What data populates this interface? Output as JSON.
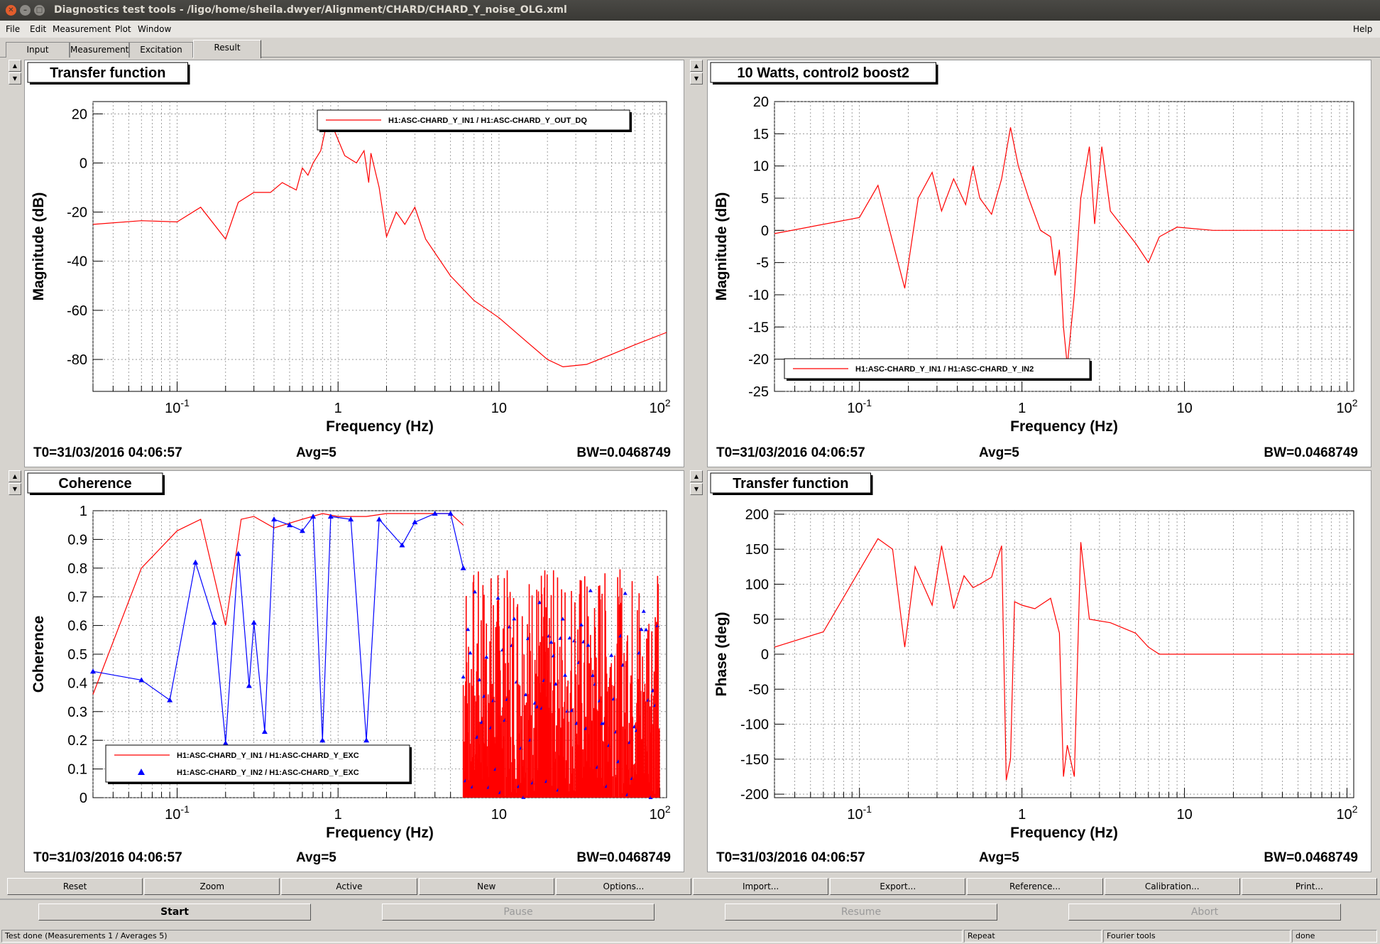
{
  "window": {
    "title": "Diagnostics test tools - /ligo/home/sheila.dwyer/Alignment/CHARD/CHARD_Y_noise_OLG.xml"
  },
  "menu": {
    "file": "File",
    "edit": "Edit",
    "measurement": "Measurement",
    "plot": "Plot",
    "window": "Window",
    "help": "Help"
  },
  "tabs": [
    {
      "label": "Input"
    },
    {
      "label": "Measurement"
    },
    {
      "label": "Excitation"
    },
    {
      "label": "Result"
    }
  ],
  "pads": [
    {
      "title": "Transfer function",
      "ylabel": "Magnitude (dB)",
      "xlabel": "Frequency (Hz)",
      "t0": "T0=31/03/2016 04:06:57",
      "avg": "Avg=5",
      "bw": "BW=0.0468749",
      "legend": [
        "H1:ASC-CHARD_Y_IN1 / H1:ASC-CHARD_Y_OUT_DQ"
      ]
    },
    {
      "title": "10 Watts, control2 boost2",
      "ylabel": "Magnitude (dB)",
      "xlabel": "Frequency (Hz)",
      "t0": "T0=31/03/2016 04:06:57",
      "avg": "Avg=5",
      "bw": "BW=0.0468749",
      "legend": [
        "H1:ASC-CHARD_Y_IN1 / H1:ASC-CHARD_Y_IN2"
      ]
    },
    {
      "title": "Coherence",
      "ylabel": "Coherence",
      "xlabel": "Frequency (Hz)",
      "t0": "T0=31/03/2016 04:06:57",
      "avg": "Avg=5",
      "bw": "BW=0.0468749",
      "legend": [
        "H1:ASC-CHARD_Y_IN1 / H1:ASC-CHARD_Y_EXC",
        "H1:ASC-CHARD_Y_IN2 / H1:ASC-CHARD_Y_EXC"
      ]
    },
    {
      "title": "Transfer function",
      "ylabel": "Phase (deg)",
      "xlabel": "Frequency (Hz)",
      "t0": "T0=31/03/2016 04:06:57",
      "avg": "Avg=5",
      "bw": "BW=0.0468749",
      "legend": []
    }
  ],
  "buttons_row1": [
    "Reset",
    "Zoom",
    "Active",
    "New",
    "Options...",
    "Import...",
    "Export...",
    "Reference...",
    "Calibration...",
    "Print..."
  ],
  "buttons_row2": [
    "Start",
    "Pause",
    "Resume",
    "Abort"
  ],
  "status": {
    "left": "Test done (Measurements 1 / Averages 5)",
    "repeat": "Repeat",
    "fourier": "Fourier tools",
    "done": "done"
  },
  "colors": {
    "series1": "#ff0000",
    "series2": "#0000ff",
    "background": "#d6d3ce"
  },
  "chart_data": [
    {
      "type": "line",
      "xscale": "log",
      "xlim": [
        0.03,
        110
      ],
      "ylim": [
        -93,
        25
      ],
      "yticks": [
        20,
        0,
        -20,
        -40,
        -60,
        -80
      ],
      "xticklabels": [
        "10^-1",
        "1",
        "10",
        "10^2"
      ],
      "series": [
        {
          "name": "H1:ASC-CHARD_Y_IN1 / H1:ASC-CHARD_Y_OUT_DQ",
          "color": "#ff0000",
          "points": [
            [
              0.03,
              -25
            ],
            [
              0.06,
              -23.5
            ],
            [
              0.1,
              -24
            ],
            [
              0.14,
              -18
            ],
            [
              0.2,
              -31
            ],
            [
              0.24,
              -16
            ],
            [
              0.3,
              -12
            ],
            [
              0.38,
              -12
            ],
            [
              0.45,
              -8
            ],
            [
              0.55,
              -11
            ],
            [
              0.6,
              -2
            ],
            [
              0.65,
              -5
            ],
            [
              0.7,
              0
            ],
            [
              0.78,
              5
            ],
            [
              0.85,
              16
            ],
            [
              0.95,
              13
            ],
            [
              1.1,
              3
            ],
            [
              1.3,
              0
            ],
            [
              1.45,
              5
            ],
            [
              1.55,
              -8
            ],
            [
              1.6,
              4
            ],
            [
              1.8,
              -10
            ],
            [
              2.0,
              -30
            ],
            [
              2.3,
              -20
            ],
            [
              2.6,
              -25
            ],
            [
              3.0,
              -18
            ],
            [
              3.5,
              -31
            ],
            [
              5,
              -46
            ],
            [
              7,
              -56
            ],
            [
              10,
              -63
            ],
            [
              15,
              -73
            ],
            [
              20,
              -80
            ],
            [
              25,
              -83
            ],
            [
              35,
              -82
            ],
            [
              50,
              -78
            ],
            [
              70,
              -74
            ],
            [
              110,
              -69
            ]
          ]
        }
      ]
    },
    {
      "type": "line",
      "xscale": "log",
      "xlim": [
        0.03,
        110
      ],
      "ylim": [
        -25,
        20
      ],
      "yticks": [
        20,
        15,
        10,
        5,
        0,
        -5,
        -10,
        -15,
        -20,
        -25
      ],
      "xticklabels": [
        "10^-1",
        "1",
        "10",
        "10^2"
      ],
      "series": [
        {
          "name": "H1:ASC-CHARD_Y_IN1 / H1:ASC-CHARD_Y_IN2",
          "color": "#ff0000",
          "points": [
            [
              0.03,
              -0.5
            ],
            [
              0.1,
              2
            ],
            [
              0.13,
              7
            ],
            [
              0.19,
              -9
            ],
            [
              0.23,
              5
            ],
            [
              0.28,
              9
            ],
            [
              0.32,
              3
            ],
            [
              0.38,
              8
            ],
            [
              0.45,
              4
            ],
            [
              0.5,
              10
            ],
            [
              0.55,
              5
            ],
            [
              0.65,
              2.5
            ],
            [
              0.75,
              8
            ],
            [
              0.85,
              16
            ],
            [
              0.95,
              10
            ],
            [
              1.1,
              5
            ],
            [
              1.3,
              0
            ],
            [
              1.5,
              -1
            ],
            [
              1.6,
              -7
            ],
            [
              1.7,
              -3
            ],
            [
              1.8,
              -15
            ],
            [
              1.9,
              -21
            ],
            [
              2.1,
              -10
            ],
            [
              2.3,
              5
            ],
            [
              2.6,
              13
            ],
            [
              2.8,
              1
            ],
            [
              3.1,
              13
            ],
            [
              3.5,
              3
            ],
            [
              5,
              -2
            ],
            [
              6,
              -5
            ],
            [
              7,
              -1
            ],
            [
              9,
              0.5
            ],
            [
              15,
              0
            ],
            [
              110,
              0
            ]
          ]
        }
      ]
    },
    {
      "type": "scatter",
      "xscale": "log",
      "xlim": [
        0.03,
        110
      ],
      "ylim": [
        0,
        1
      ],
      "yticks": [
        1,
        0.9,
        0.8,
        0.7,
        0.6,
        0.5,
        0.4,
        0.3,
        0.2,
        0.1,
        0
      ],
      "xticklabels": [
        "10^-1",
        "1",
        "10",
        "10^2"
      ],
      "series": [
        {
          "name": "H1:ASC-CHARD_Y_IN1 / H1:ASC-CHARD_Y_EXC",
          "color": "#ff0000",
          "points": [
            [
              0.03,
              0.36
            ],
            [
              0.06,
              0.8
            ],
            [
              0.1,
              0.93
            ],
            [
              0.14,
              0.97
            ],
            [
              0.2,
              0.6
            ],
            [
              0.25,
              0.97
            ],
            [
              0.3,
              0.98
            ],
            [
              0.4,
              0.94
            ],
            [
              0.6,
              0.97
            ],
            [
              0.8,
              0.99
            ],
            [
              1.0,
              0.98
            ],
            [
              1.5,
              0.98
            ],
            [
              2,
              0.99
            ],
            [
              3,
              0.99
            ],
            [
              5,
              0.99
            ],
            [
              6,
              0.95
            ]
          ]
        },
        {
          "name": "H1:ASC-CHARD_Y_IN2 / H1:ASC-CHARD_Y_EXC",
          "color": "#0000ff",
          "points": [
            [
              0.03,
              0.44
            ],
            [
              0.06,
              0.41
            ],
            [
              0.09,
              0.34
            ],
            [
              0.13,
              0.82
            ],
            [
              0.17,
              0.61
            ],
            [
              0.2,
              0.19
            ],
            [
              0.24,
              0.85
            ],
            [
              0.28,
              0.39
            ],
            [
              0.3,
              0.61
            ],
            [
              0.35,
              0.23
            ],
            [
              0.4,
              0.97
            ],
            [
              0.5,
              0.95
            ],
            [
              0.6,
              0.93
            ],
            [
              0.7,
              0.98
            ],
            [
              0.8,
              0.2
            ],
            [
              0.9,
              0.98
            ],
            [
              1.2,
              0.97
            ],
            [
              1.5,
              0.2
            ],
            [
              1.8,
              0.97
            ],
            [
              2.5,
              0.88
            ],
            [
              3,
              0.96
            ],
            [
              4,
              0.99
            ],
            [
              5,
              0.99
            ],
            [
              6,
              0.8
            ]
          ]
        }
      ]
    },
    {
      "type": "line",
      "xscale": "log",
      "xlim": [
        0.03,
        110
      ],
      "ylim": [
        -205,
        205
      ],
      "yticks": [
        200,
        150,
        100,
        50,
        0,
        -50,
        -100,
        -150,
        -200
      ],
      "xticklabels": [
        "10^-1",
        "1",
        "10",
        "10^2"
      ],
      "series": [
        {
          "name": "",
          "color": "#ff0000",
          "points": [
            [
              0.03,
              10
            ],
            [
              0.06,
              32
            ],
            [
              0.13,
              165
            ],
            [
              0.16,
              150
            ],
            [
              0.19,
              10
            ],
            [
              0.22,
              125
            ],
            [
              0.28,
              70
            ],
            [
              0.32,
              155
            ],
            [
              0.38,
              65
            ],
            [
              0.44,
              112
            ],
            [
              0.5,
              95
            ],
            [
              0.55,
              100
            ],
            [
              0.65,
              110
            ],
            [
              0.75,
              155
            ],
            [
              0.8,
              -180
            ],
            [
              0.85,
              -150
            ],
            [
              0.9,
              75
            ],
            [
              1.0,
              70
            ],
            [
              1.2,
              65
            ],
            [
              1.5,
              80
            ],
            [
              1.7,
              30
            ],
            [
              1.8,
              -175
            ],
            [
              1.9,
              -130
            ],
            [
              2.1,
              -175
            ],
            [
              2.3,
              160
            ],
            [
              2.6,
              50
            ],
            [
              3.5,
              45
            ],
            [
              5,
              30
            ],
            [
              6,
              10
            ],
            [
              7,
              0
            ],
            [
              110,
              0
            ]
          ]
        }
      ]
    }
  ]
}
